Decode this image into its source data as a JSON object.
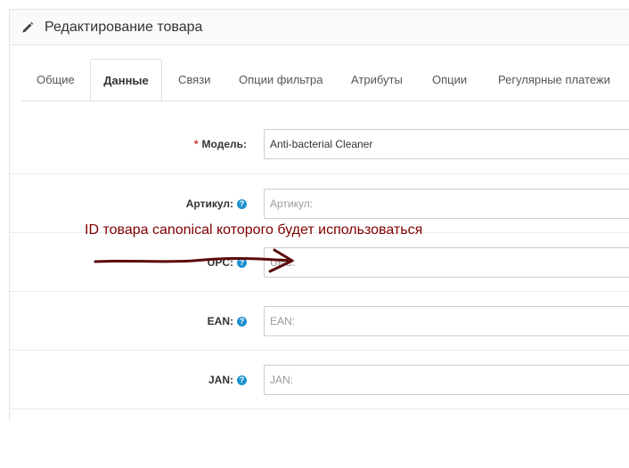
{
  "header": {
    "icon": "pencil-icon",
    "title": "Редактирование товара"
  },
  "tabs": [
    {
      "label": "Общие",
      "active": false
    },
    {
      "label": "Данные",
      "active": true
    },
    {
      "label": "Связи",
      "active": false
    },
    {
      "label": "Опции фильтра",
      "active": false
    },
    {
      "label": "Атрибуты",
      "active": false
    },
    {
      "label": "Опции",
      "active": false
    },
    {
      "label": "Регулярные платежи",
      "active": false
    }
  ],
  "fields": {
    "model": {
      "label": "Модель:",
      "required_mark": "*",
      "value": "Anti-bacterial Cleaner",
      "placeholder": ""
    },
    "sku": {
      "label": "Артикул:",
      "value": "",
      "placeholder": "Артикул:",
      "help_icon": "question-icon"
    },
    "upc": {
      "label": "UPC:",
      "value": "",
      "placeholder": "UPC:",
      "help_icon": "question-icon"
    },
    "ean": {
      "label": "EAN:",
      "value": "",
      "placeholder": "EAN:",
      "help_icon": "question-icon"
    },
    "jan": {
      "label": "JAN:",
      "value": "",
      "placeholder": "JAN:",
      "help_icon": "question-icon"
    }
  },
  "annotation": {
    "text": "ID товара canonical которого будет использоваться",
    "color": "#800000"
  },
  "colors": {
    "required": "#c9302c",
    "help_icon": "#1e91cf",
    "border": "#cccccc"
  }
}
